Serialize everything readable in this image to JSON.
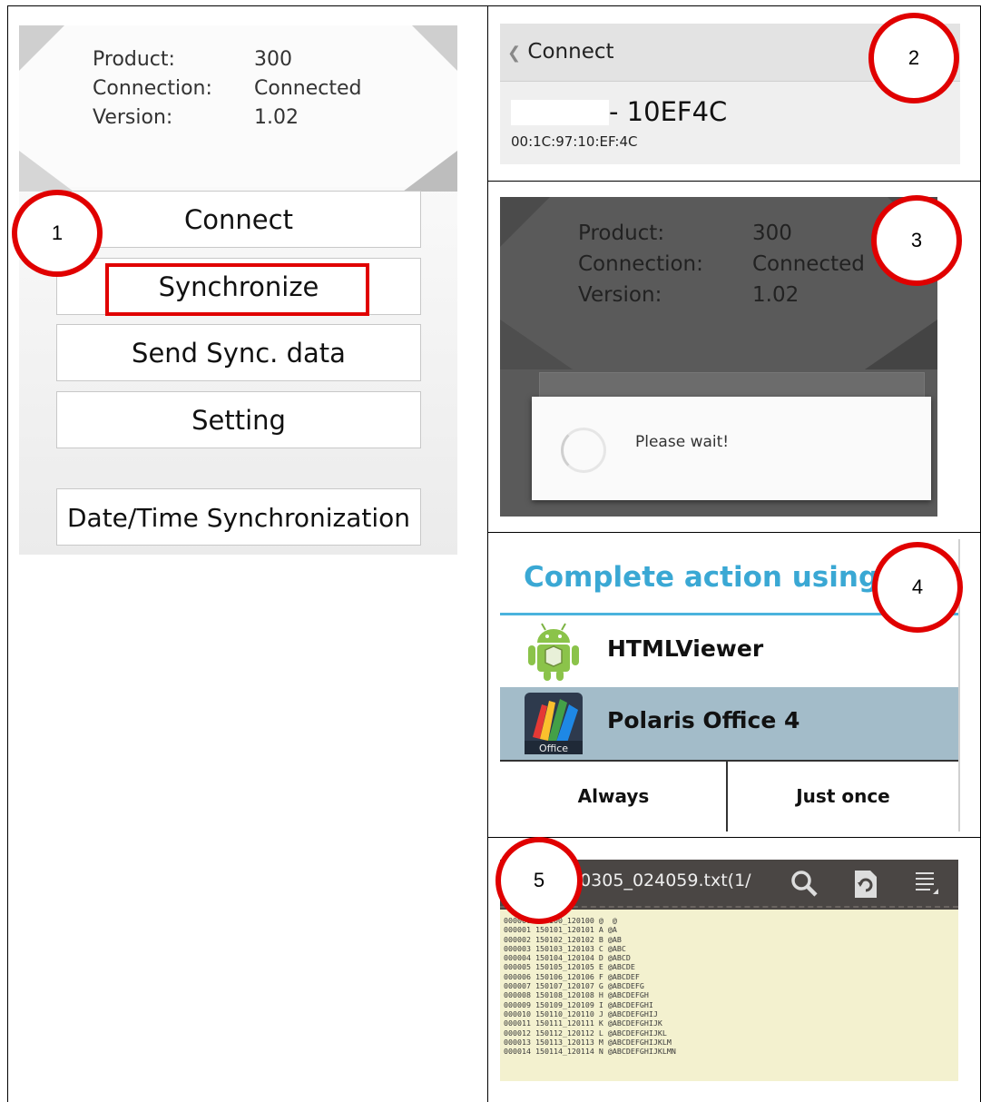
{
  "panel1": {
    "info": [
      {
        "label": "Product:",
        "value": "300"
      },
      {
        "label": "Connection:",
        "value": "Connected"
      },
      {
        "label": "Version:",
        "value": "1.02"
      }
    ],
    "buttons": [
      "Connect",
      "Synchronize",
      "Send Sync. data",
      "Setting",
      "Date/Time Synchronization"
    ],
    "highlighted": "Synchronize",
    "step": "1"
  },
  "panel2": {
    "back_label": "Connect",
    "device_name": "- 10EF4C",
    "mac": "00:1C:97:10:EF:4C",
    "step": "2"
  },
  "panel3": {
    "info": [
      {
        "label": "Product:",
        "value": "300"
      },
      {
        "label": "Connection:",
        "value": "Connected"
      },
      {
        "label": "Version:",
        "value": "1.02"
      }
    ],
    "dialog_text": "Please wait!",
    "step": "3"
  },
  "panel4": {
    "title": "Complete action using",
    "apps": [
      {
        "name": "HTMLViewer",
        "icon": "android-icon",
        "selected": false
      },
      {
        "name": "Polaris Office 4",
        "icon": "polaris-office-icon",
        "icon_caption": "Office",
        "selected": true
      }
    ],
    "always": "Always",
    "just_once": "Just once",
    "step": "4"
  },
  "panel5": {
    "filename": "50305_024059.txt(1/",
    "lines": [
      "000000 150100_120100 @  @",
      "000001 150101_120101 A @A",
      "000002 150102_120102 B @AB",
      "000003 150103_120103 C @ABC",
      "000004 150104_120104 D @ABCD",
      "000005 150105_120105 E @ABCDE",
      "000006 150106_120106 F @ABCDEF",
      "000007 150107_120107 G @ABCDEFG",
      "000008 150108_120108 H @ABCDEFGH",
      "000009 150109_120109 I @ABCDEFGHI",
      "000010 150110_120110 J @ABCDEFGHIJ",
      "000011 150111_120111 K @ABCDEFGHIJK",
      "000012 150112_120112 L @ABCDEFGHIJKL",
      "000013 150113_120113 M @ABCDEFGHIJKLM",
      "000014 150114_120114 N @ABCDEFGHIJKLMN"
    ],
    "icons": [
      "search-icon",
      "document-refresh-icon",
      "menu-icon"
    ],
    "step": "5"
  },
  "colors": {
    "annotation": "#e00000",
    "accent": "#3aa8d4",
    "selection": "#a3bcc9"
  }
}
